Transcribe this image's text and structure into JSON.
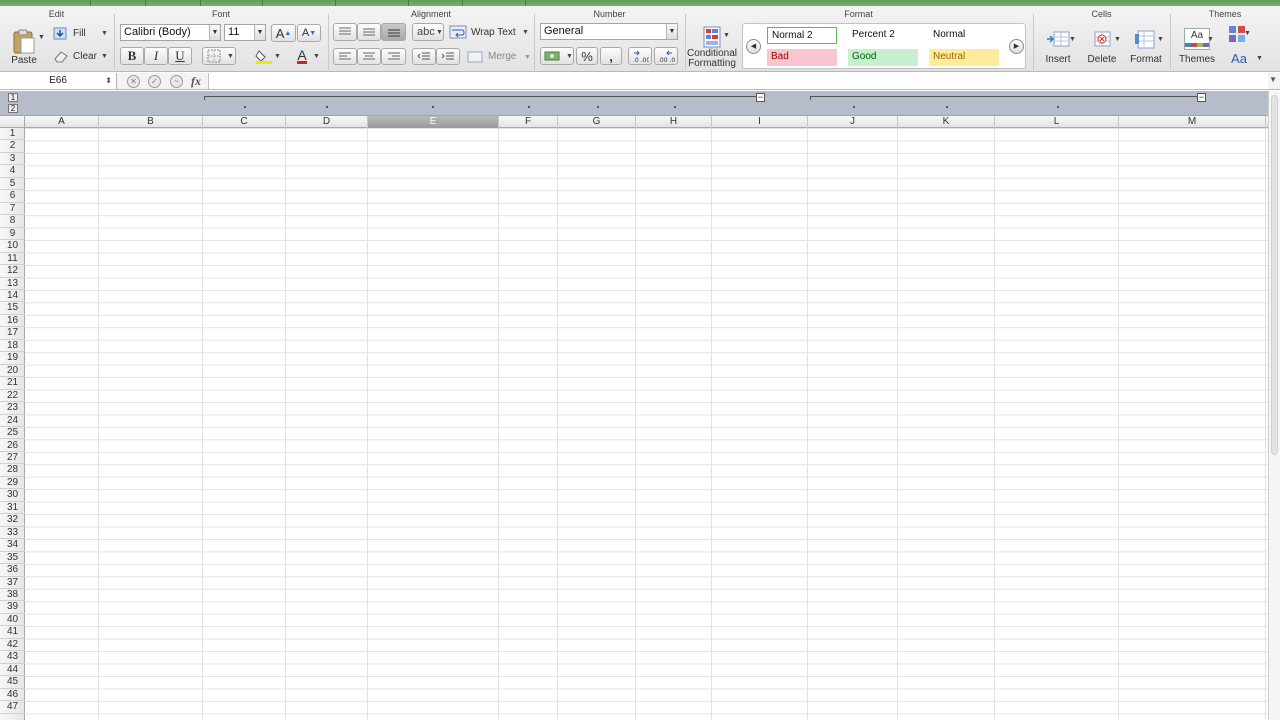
{
  "ribbon": {
    "groups": {
      "edit": "Edit",
      "font": "Font",
      "alignment": "Alignment",
      "number": "Number",
      "format": "Format",
      "cells": "Cells",
      "themes": "Themes"
    },
    "edit": {
      "paste": "Paste",
      "fill": "Fill",
      "clear": "Clear"
    },
    "font": {
      "family": "Calibri (Body)",
      "size": "11",
      "bold": "B",
      "italic": "I",
      "underline": "U",
      "grow": "A",
      "shrink": "A",
      "font_color": "A"
    },
    "alignment": {
      "orientation": "abc",
      "wrap_text": "Wrap Text",
      "merge": "Merge"
    },
    "number": {
      "format": "General",
      "percent": "%",
      "comma": ",",
      "inc_decimal": ".0 .00",
      "dec_decimal": ".00 .0"
    },
    "conditional_formatting": [
      "Conditional",
      "Formatting"
    ],
    "styles": [
      {
        "label": "Normal 2",
        "bg": "#ffffff",
        "border": "#5cb85c",
        "color": "#111111"
      },
      {
        "label": "Percent 2",
        "bg": "transparent",
        "border": "transparent",
        "color": "#111111"
      },
      {
        "label": "Normal",
        "bg": "transparent",
        "border": "transparent",
        "color": "#111111"
      },
      {
        "label": "Bad",
        "bg": "#f7c6ce",
        "border": "transparent",
        "color": "#9c0006"
      },
      {
        "label": "Good",
        "bg": "#c6efce",
        "border": "transparent",
        "color": "#006100"
      },
      {
        "label": "Neutral",
        "bg": "#ffeb9c",
        "border": "transparent",
        "color": "#9c6500"
      }
    ],
    "cells": {
      "insert": "Insert",
      "delete": "Delete",
      "format": "Format"
    },
    "themes": {
      "themes": "Themes",
      "theme_glyph": "Aa",
      "fonts_glyph": "Aa"
    }
  },
  "formula_bar": {
    "name_box": "E66",
    "fx": "fx",
    "formula": ""
  },
  "outline": {
    "levels": [
      "1",
      "2"
    ],
    "collapse": "−"
  },
  "columns": [
    "A",
    "B",
    "C",
    "D",
    "E",
    "F",
    "G",
    "H",
    "I",
    "J",
    "K",
    "L",
    "M"
  ],
  "selected_column": "E",
  "rows": [
    "1",
    "2",
    "3",
    "4",
    "5",
    "6",
    "7",
    "8",
    "9",
    "10",
    "11",
    "12",
    "13",
    "14",
    "15",
    "16",
    "17",
    "18",
    "19",
    "20",
    "21",
    "22",
    "23",
    "24",
    "25",
    "26",
    "27",
    "28",
    "29",
    "30",
    "31",
    "32",
    "33",
    "34",
    "35",
    "36",
    "37",
    "38",
    "39",
    "40",
    "41",
    "42",
    "43",
    "44",
    "45",
    "46",
    "47"
  ]
}
